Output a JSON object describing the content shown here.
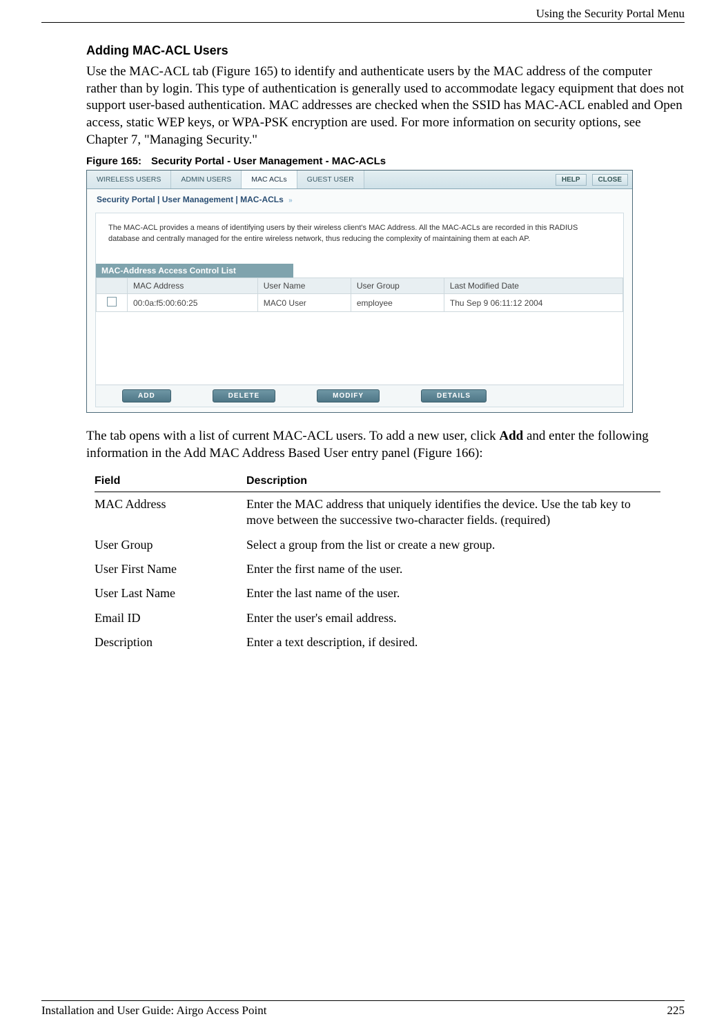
{
  "header": {
    "title": "Using the Security Portal Menu"
  },
  "section": {
    "heading": "Adding MAC-ACL Users"
  },
  "para1": "Use the MAC-ACL tab (Figure 165) to identify and authenticate users by the MAC address of the computer rather than by login. This type of authentication is generally used to accommodate legacy equipment that does not support user-based authentication. MAC addresses are checked when the SSID has MAC-ACL enabled and Open access, static WEP keys, or WPA-PSK encryption are used. For more information on security options, see Chapter 7,  \"Managing Security.\"",
  "figure": {
    "label_num": "Figure 165:",
    "label_text": "Security Portal - User Management - MAC-ACLs",
    "tabs": [
      "WIRELESS USERS",
      "ADMIN USERS",
      "MAC ACLs",
      "GUEST USER"
    ],
    "help": "HELP",
    "close": "CLOSE",
    "breadcrumb": "Security Portal | User Management | MAC-ACLs",
    "desc": "The MAC-ACL provides a means of identifying users by their wireless client's MAC Address. All the MAC-ACLs are recorded in this RADIUS database and centrally managed for the entire wireless network, thus reducing the complexity of maintaining them at each AP.",
    "subhead": "MAC-Address Access Control List",
    "table_headers": [
      "MAC Address",
      "User Name",
      "User Group",
      "Last Modified Date"
    ],
    "rows": [
      {
        "mac": "00:0a:f5:00:60:25",
        "user": "MAC0 User",
        "group": "employee",
        "date": "Thu Sep 9 06:11:12 2004"
      }
    ],
    "buttons": [
      "ADD",
      "DELETE",
      "MODIFY",
      "DETAILS"
    ]
  },
  "para2_pre": "The tab opens with a list of current MAC-ACL users. To add a new user, click ",
  "para2_bold": "Add",
  "para2_post": " and enter the following information in the Add MAC Address Based User entry panel (Figure 166):",
  "field_table": {
    "header": {
      "field": "Field",
      "description": "Description"
    },
    "rows": [
      {
        "field": "MAC Address",
        "desc": "Enter the MAC address that uniquely identifies the device. Use the tab key to move between the successive two-character fields. (required)"
      },
      {
        "field": "User Group",
        "desc": "Select a group from the list or create a new group."
      },
      {
        "field": "User First Name",
        "desc": "Enter the first name of the user."
      },
      {
        "field": "User Last Name",
        "desc": "Enter the last name of the user."
      },
      {
        "field": "Email ID",
        "desc": "Enter the user's email address."
      },
      {
        "field": "Description",
        "desc": "Enter a text description, if desired."
      }
    ]
  },
  "footer": {
    "left": "Installation and User Guide: Airgo Access Point",
    "right": "225"
  }
}
